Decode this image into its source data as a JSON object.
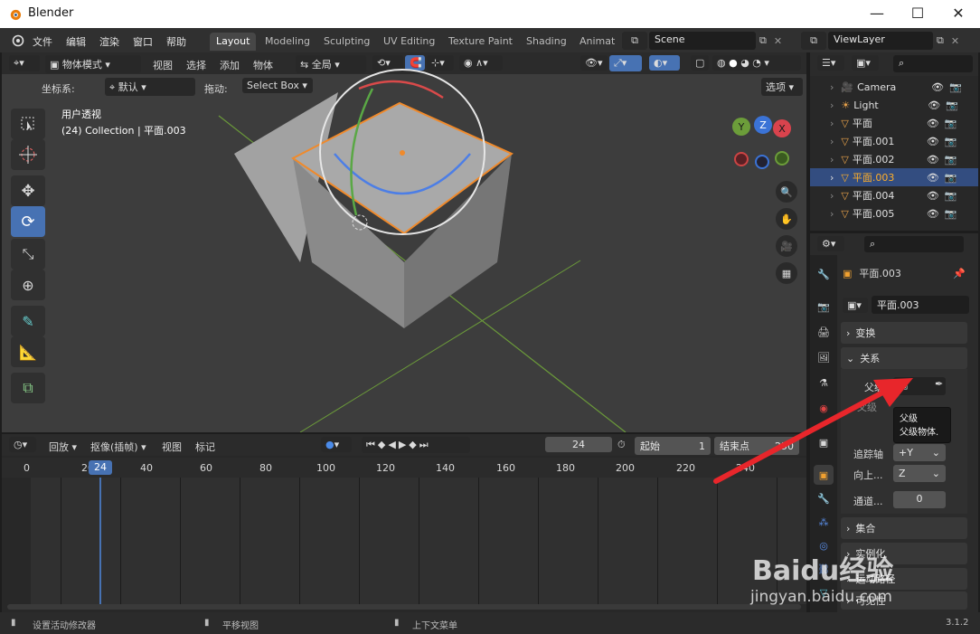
{
  "window": {
    "title": "Blender"
  },
  "menu": {
    "items": [
      "文件",
      "编辑",
      "渲染",
      "窗口",
      "帮助"
    ]
  },
  "workspaces": {
    "tabs": [
      "Layout",
      "Modeling",
      "Sculpting",
      "UV Editing",
      "Texture Paint",
      "Shading",
      "Animat"
    ],
    "active": "Layout"
  },
  "scene": {
    "name": "Scene",
    "view_layer": "ViewLayer"
  },
  "viewport": {
    "mode": "物体模式",
    "menus": [
      "视图",
      "选择",
      "添加",
      "物体"
    ],
    "transform_orientation": "全局",
    "coord_label": "坐标系:",
    "coord_value": "默认",
    "drag_label": "拖动:",
    "drag_value": "Select Box",
    "options_label": "选项",
    "view_name": "用户透视",
    "view_info": "(24) Collection | 平面.003",
    "gizmo_axes": [
      "Y",
      "Z",
      "X"
    ]
  },
  "timeline": {
    "playback": "回放",
    "keying": "抠像(插帧)",
    "menus": [
      "视图",
      "标记"
    ],
    "current_frame": "24",
    "start_label": "起始",
    "start_value": "1",
    "end_label": "结束点",
    "end_value": "250",
    "ruler": [
      "0",
      "20",
      "40",
      "60",
      "80",
      "100",
      "120",
      "140",
      "160",
      "180",
      "200",
      "220",
      "240"
    ]
  },
  "outliner": {
    "items": [
      {
        "name": "Camera",
        "selected": false,
        "icon": "camera-icon"
      },
      {
        "name": "Light",
        "selected": false,
        "icon": "light-icon"
      },
      {
        "name": "平面",
        "selected": false,
        "icon": "mesh-icon"
      },
      {
        "name": "平面.001",
        "selected": false,
        "icon": "mesh-icon"
      },
      {
        "name": "平面.002",
        "selected": false,
        "icon": "mesh-icon"
      },
      {
        "name": "平面.003",
        "selected": true,
        "icon": "mesh-icon"
      },
      {
        "name": "平面.004",
        "selected": false,
        "icon": "mesh-icon"
      },
      {
        "name": "平面.005",
        "selected": false,
        "icon": "mesh-icon"
      }
    ]
  },
  "properties": {
    "object_name": "平面.003",
    "data_name": "平面.003",
    "panels": {
      "transform": "变换",
      "relations": "关系",
      "parent_label": "父级",
      "parent_type_label": "父级",
      "track_axis_label": "追踪轴",
      "track_axis_value": "+Y",
      "up_axis_label": "向上...",
      "up_axis_value": "Z",
      "pass_label": "通道...",
      "pass_value": "0",
      "collections": "集合",
      "instancing": "实例化",
      "motion_paths": "运动路径",
      "visibility": "可见性"
    },
    "tooltip": {
      "title": "父级",
      "desc": "父级物体."
    }
  },
  "statusbar": {
    "left": "设置活动修改器",
    "mid": "平移视图",
    "right": "上下文菜单",
    "version": "3.1.2"
  },
  "watermark": {
    "brand": "Baidu经验",
    "url": "jingyan.baidu.com"
  },
  "colors": {
    "accent": "#4772b3",
    "selected_orange": "#ffaf29",
    "arrow": "#e8262b"
  }
}
